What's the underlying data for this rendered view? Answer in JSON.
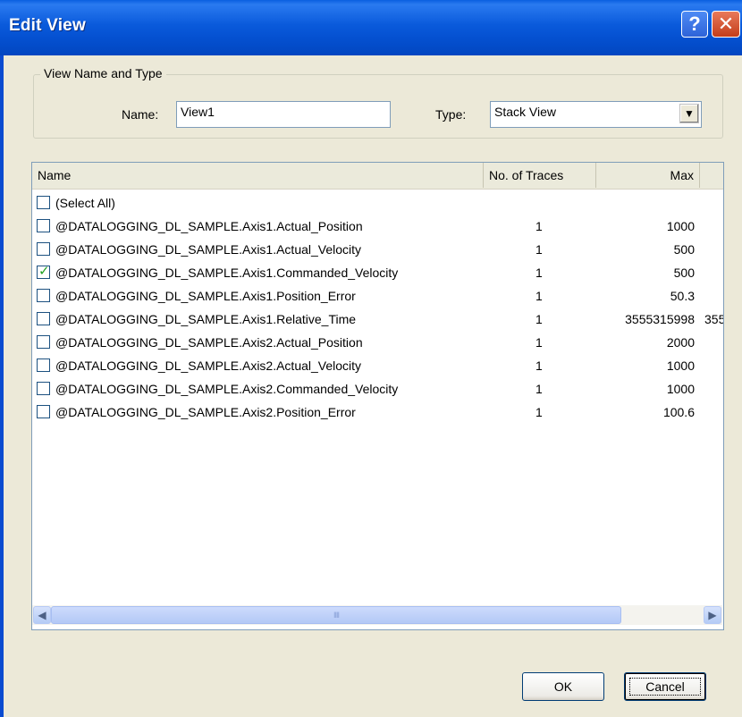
{
  "window": {
    "title": "Edit View",
    "help_glyph": "?",
    "close_glyph": "✕"
  },
  "group": {
    "legend": "View Name and Type",
    "name_label": "Name:",
    "name_value": "View1",
    "type_label": "Type:",
    "type_value": "Stack View",
    "dropdown_glyph": "▼"
  },
  "list": {
    "columns": [
      "Name",
      "No. of Traces",
      "Max"
    ],
    "rows": [
      {
        "name": "(Select All)",
        "traces": "",
        "max": "",
        "extra": "",
        "checked": false
      },
      {
        "name": "@DATALOGGING_DL_SAMPLE.Axis1.Actual_Position",
        "traces": "1",
        "max": "1000",
        "extra": "",
        "checked": false
      },
      {
        "name": "@DATALOGGING_DL_SAMPLE.Axis1.Actual_Velocity",
        "traces": "1",
        "max": "500",
        "extra": "",
        "checked": false
      },
      {
        "name": "@DATALOGGING_DL_SAMPLE.Axis1.Commanded_Velocity",
        "traces": "1",
        "max": "500",
        "extra": "",
        "checked": true
      },
      {
        "name": "@DATALOGGING_DL_SAMPLE.Axis1.Position_Error",
        "traces": "1",
        "max": "50.3",
        "extra": "",
        "checked": false
      },
      {
        "name": "@DATALOGGING_DL_SAMPLE.Axis1.Relative_Time",
        "traces": "1",
        "max": "3555315998",
        "extra": "355",
        "checked": false
      },
      {
        "name": "@DATALOGGING_DL_SAMPLE.Axis2.Actual_Position",
        "traces": "1",
        "max": "2000",
        "extra": "",
        "checked": false
      },
      {
        "name": "@DATALOGGING_DL_SAMPLE.Axis2.Actual_Velocity",
        "traces": "1",
        "max": "1000",
        "extra": "",
        "checked": false
      },
      {
        "name": "@DATALOGGING_DL_SAMPLE.Axis2.Commanded_Velocity",
        "traces": "1",
        "max": "1000",
        "extra": "",
        "checked": false
      },
      {
        "name": "@DATALOGGING_DL_SAMPLE.Axis2.Position_Error",
        "traces": "1",
        "max": "100.6",
        "extra": "",
        "checked": false
      }
    ],
    "scroll_left_glyph": "◀",
    "scroll_right_glyph": "▶",
    "thumb_grip": "IIII"
  },
  "buttons": {
    "ok": "OK",
    "cancel": "Cancel"
  }
}
